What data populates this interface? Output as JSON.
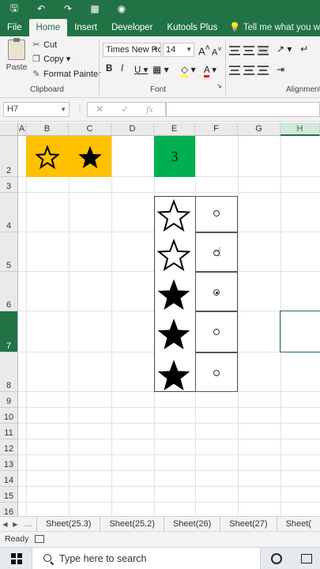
{
  "qat": {
    "icons": [
      "save-icon",
      "undo-icon",
      "redo-icon",
      "form-icon",
      "camera-icon"
    ]
  },
  "tabs": [
    "File",
    "Home",
    "Insert",
    "Developer",
    "Kutools Plus"
  ],
  "active_tab": "Home",
  "tell_me": "Tell me what you want",
  "clipboard": {
    "paste": "Paste",
    "cut": "Cut",
    "copy": "Copy",
    "format_painter": "Format Painter",
    "group": "Clipboard"
  },
  "font": {
    "name": "Times New Ro",
    "size": "14",
    "bold": "B",
    "italic": "I",
    "underline": "U",
    "grow": "A",
    "shrink": "A",
    "color_glyph": "A",
    "group": "Font"
  },
  "alignment": {
    "group": "Alignment"
  },
  "formula_bar": {
    "name_box": "H7",
    "cancel": "✕",
    "enter": "✓",
    "fx": "fx"
  },
  "columns": [
    "A",
    "B",
    "C",
    "D",
    "E",
    "F",
    "G",
    "H"
  ],
  "rows": [
    "2",
    "3",
    "4",
    "5",
    "6",
    "7",
    "8",
    "9",
    "10",
    "11",
    "12",
    "13",
    "14",
    "15",
    "16"
  ],
  "cells": {
    "e2_value": "3"
  },
  "rating": {
    "stars": [
      "outline",
      "outline",
      "filled",
      "filled",
      "filled"
    ],
    "radio_selected_index": 2
  },
  "sheet_tabs": [
    "Sheet(25.3)",
    "Sheet(25.2)",
    "Sheet(26)",
    "Sheet(27)",
    "Sheet("
  ],
  "sheet_nav": {
    "prev": "◀",
    "next": "▶",
    "more": "..."
  },
  "status": {
    "ready": "Ready"
  },
  "taskbar": {
    "search_placeholder": "Type here to search"
  },
  "colors": {
    "excel_green": "#217346",
    "gold_fill": "#FFC000",
    "green_fill": "#00B050"
  }
}
